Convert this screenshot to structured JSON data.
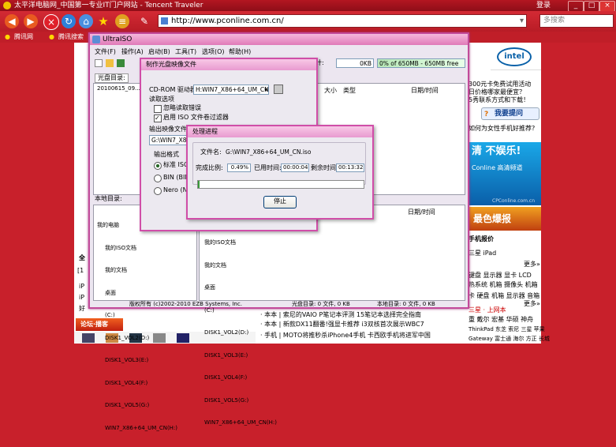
{
  "browser": {
    "title": "太平洋电脑网_中国第一专业IT门户网站 - Tencent Traveler",
    "login": "登录",
    "url": "http://www.pconline.com.cn/",
    "search_placeholder": "多搜索",
    "favorites": [
      "腾讯网",
      "腾讯搜索"
    ]
  },
  "webpage": {
    "right_lines": [
      "300元卡免费试用活动",
      "日价格哪家最便宜？",
      "5秀联系方式和下载！",
      "我要提问",
      "如何为女性手机好推荐?",
      "清 不娱乐!",
      "Conline 高清频道",
      "CPConline.com.cn",
      "最色爆报",
      "手机报价",
      "三星 iPad",
      "更多»",
      "键盘 显示器 显卡 LCD",
      "热系统 机箱 摄像头 机箱",
      "卡 硬盘 机箱 显示器 音箱",
      "更多»",
      "三星 · 上网本",
      "重 戴尔 宏基 华硕 神舟",
      "ThinkPad 东芝 索尼 三星 苹果",
      "Gateway 富士通 海尔 方正 长城"
    ],
    "left_lines": [
      "全",
      "[1",
      "iP",
      "iP",
      "好"
    ],
    "bottom_lines": [
      "· 本本 | 索尼的VAIO P笔记本评测 15笔记本选择完全指南",
      "· 本本 | 新款DX11翻番!强显卡推荐 i3双核首次展示WBC7",
      "· 手机 | MOTO将推秒杀iPhone4手机 卡西欧手机将进军中国"
    ],
    "forum_tab": "论坛·播客",
    "intel": "intel"
  },
  "uiso": {
    "title": "UltraISO",
    "menu": [
      "文件(F)",
      "操作(A)",
      "启动(B)",
      "工具(T)",
      "选项(O)",
      "帮助(H)"
    ],
    "total_label": "总计:",
    "total_size": "0KB",
    "capacity": "0% of 650MB - 650MB free",
    "disc_dir_tab": "光盘目录:",
    "disc_root": "20100615_09...",
    "columns": [
      "大小",
      "类型",
      "日期/时间"
    ],
    "local_dir_label": "本地目录:",
    "local_tree": [
      "我的电脑",
      "我的ISO文档",
      "我的文档",
      "桌面",
      "(C:)",
      "DISK1_VOL2(D:)",
      "DISK1_VOL3(E:)",
      "DISK1_VOL4(F:)",
      "DISK1_VOL5(G:)",
      "WIN7_X86+64_UM_CN(H:)"
    ],
    "local_list": [
      "我的ISO文档",
      "我的文档",
      "桌面",
      "(C:)",
      "DISK1_VOL2(D:)",
      "DISK1_VOL3(E:)",
      "DISK1_VOL4(F:)",
      "DISK1_VOL5(G:)",
      "WIN7_X86+64_UM_CN(H:)"
    ],
    "copyright": "版权所有 (c)2002-2010 EZB Systems, Inc.",
    "disc_status": "光盘目录: 0 文件, 0 KB",
    "local_status": "本地目录: 0 文件, 0 KB"
  },
  "make_dlg": {
    "title": "制作光盘映像文件",
    "cdrom_label": "CD-ROM 驱动器:",
    "cdrom_value": "H:WIN7_X86+64_UM_CN",
    "read_options": "读取选项",
    "ignore_errors": "忽略读取错误",
    "iso_filter": "启用 ISO 文件卷过滤器",
    "output_label": "输出映像文件名:",
    "output_value": "G:\\WIN7_X86+64_UM_CN.iso",
    "format_label": "输出格式",
    "fmt1": "标准 ISO",
    "fmt2": "BIN (BIN",
    "fmt3": "Nero (NRG"
  },
  "progress_dlg": {
    "title": "处理进程",
    "file_label": "文件名:",
    "file_value": "G:\\WIN7_X86+64_UM_CN.iso",
    "ratio_label": "完成比例:",
    "ratio_value": "0.49%",
    "elapsed_label": "已用时间:",
    "elapsed_value": "00:00:04",
    "remain_label": "剩余时间:",
    "remain_value": "00:13:32",
    "progress": 0.0049,
    "stop_label": "停止"
  }
}
